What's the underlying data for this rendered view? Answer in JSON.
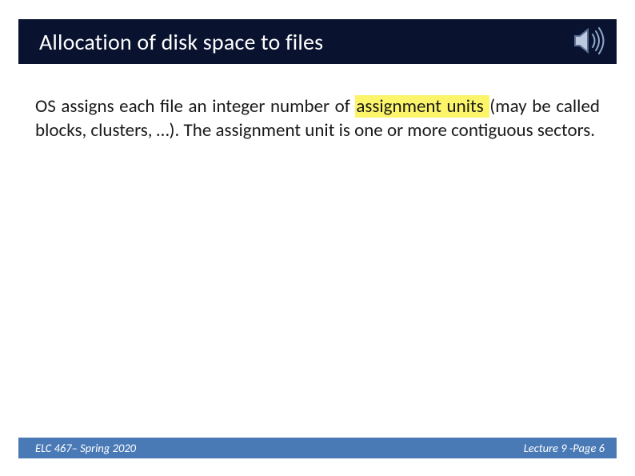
{
  "title": "Allocation of disk space to files",
  "body": {
    "pre": "OS assigns each file an integer number of ",
    "highlight": "assignment units ",
    "post": "(may be called blocks, clusters, …). The assignment unit is one or more contiguous sectors."
  },
  "footer": {
    "left": "ELC 467– Spring 2020",
    "right": "Lecture 9 -Page 6"
  },
  "icons": {
    "speaker": "speaker-icon"
  }
}
